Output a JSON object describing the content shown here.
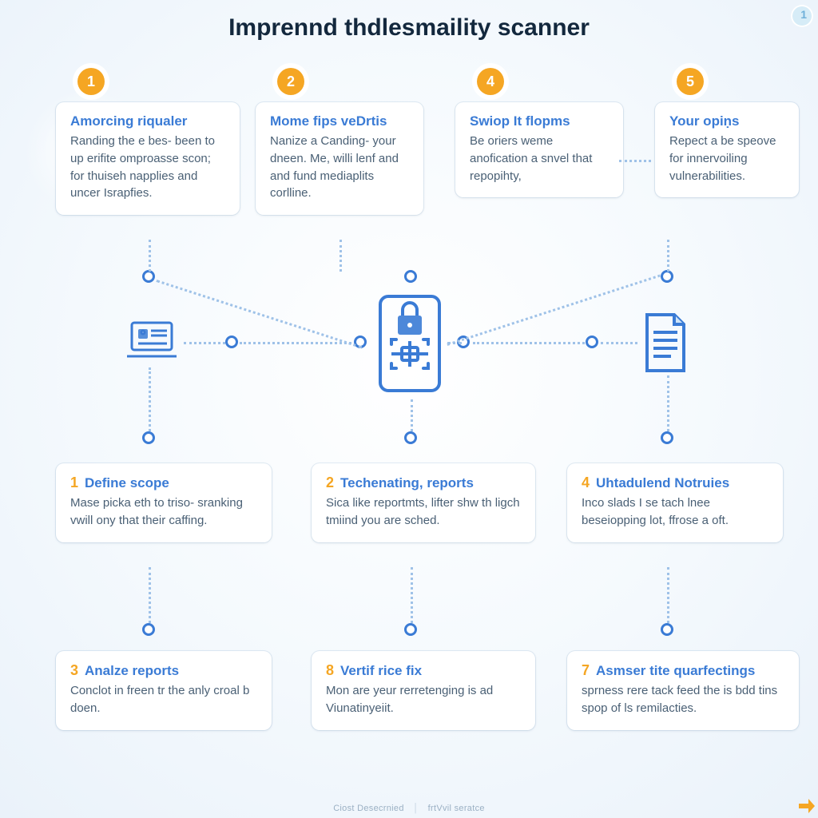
{
  "title": "Imprennd thdlesmaility scanner",
  "corner_badge": "1",
  "top_badges": [
    "1",
    "2",
    "4",
    "5"
  ],
  "top_cards": [
    {
      "heading": "Amorcing riqualer",
      "body": "Randing the e bes- been to up erifite omproasse scon; for thuiseh napplies and uncer Israpfies."
    },
    {
      "heading": "Mome fips veDrtis",
      "body": "Nanize a Canding- your dneen. Me, willi lenf and and fund mediaplits corlline."
    },
    {
      "heading": "Swiop It flopms",
      "body": "Be oriers weme anofication a snvel that repopihty,"
    },
    {
      "heading": "Your opiṇs",
      "body": "Repect a be speove for innervoiling vulnerabilities."
    }
  ],
  "mid_cards": [
    {
      "num": "1",
      "heading": "Define scope",
      "body": "Mase picka eth to triso- sranking vwill ony that their caffing."
    },
    {
      "num": "2",
      "heading": "Techenating, reports",
      "body": "Sica like reportmts, lifter shw th ligch tmiind you are sched."
    },
    {
      "num": "4",
      "heading": "Uhtadulend Notruies",
      "body": "Inco slads I se tach lnee beseiopping lot, ffrose a oft."
    }
  ],
  "bottom_cards": [
    {
      "num": "3",
      "heading": "Analze reports",
      "body": "Conclot in freen tr the anly croal b doen."
    },
    {
      "num": "8",
      "heading": "Vertif rice fix",
      "body": "Mon are yeur rerretenging is ad Viunatinyeiit."
    },
    {
      "num": "7",
      "heading": "Asmser tite quarfectings",
      "body": "sprness rere tack feed the is bdd tins spop of ls remilacties."
    }
  ],
  "footer": {
    "left": "Ciost Desecrnied",
    "right": "frtVvil seratce"
  }
}
